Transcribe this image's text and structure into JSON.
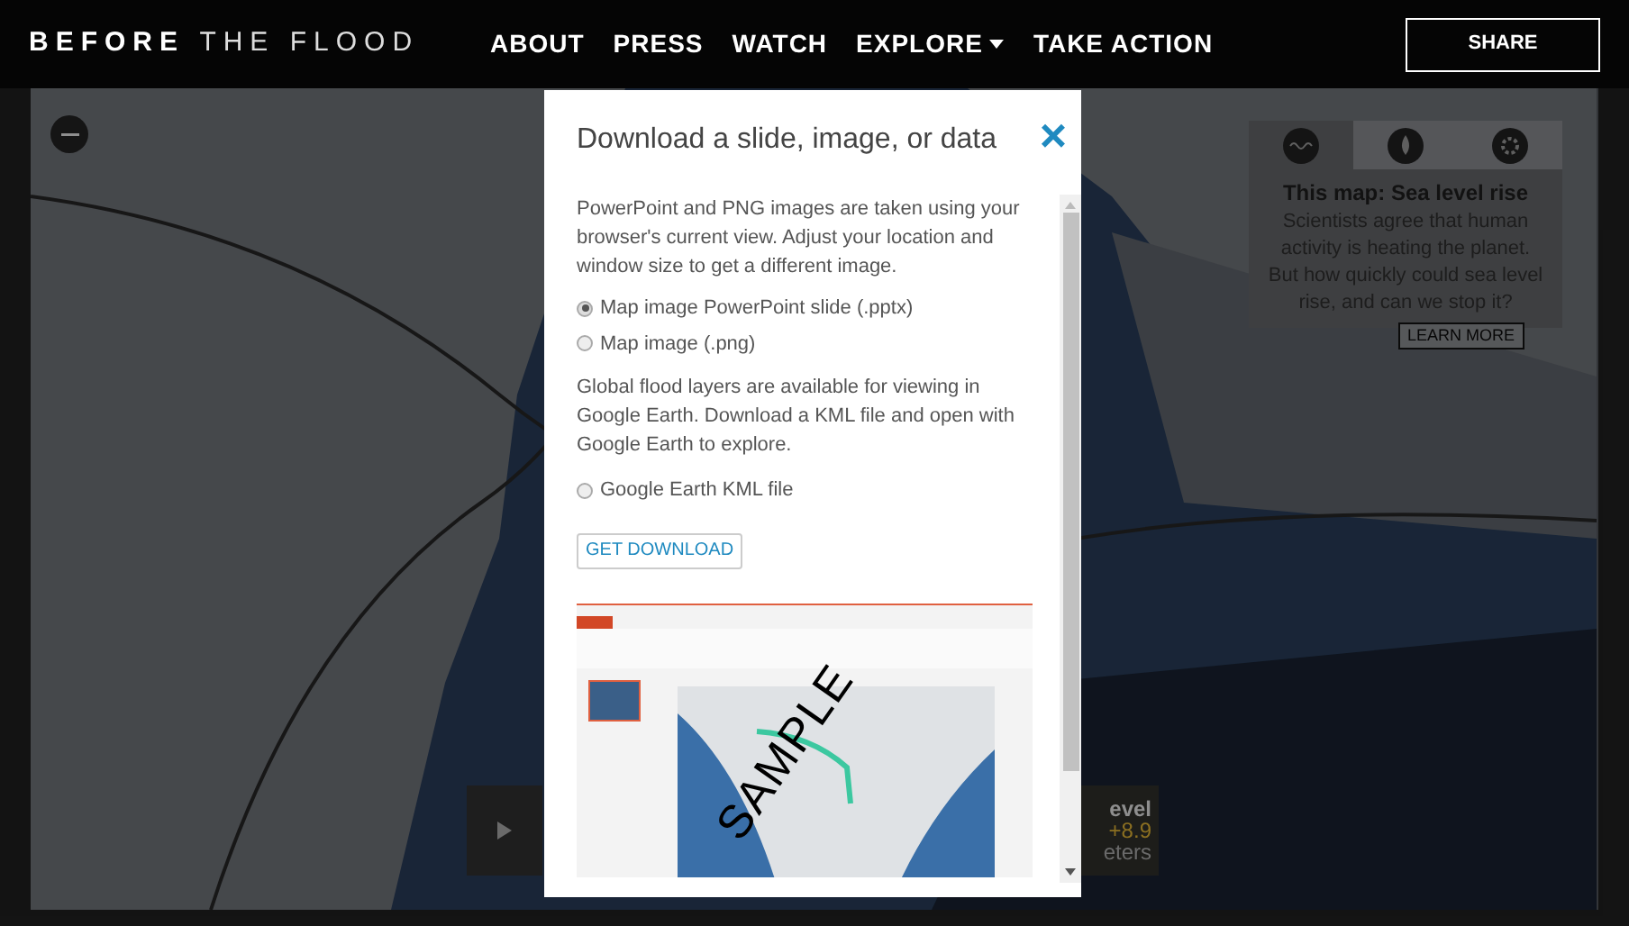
{
  "header": {
    "logo_bold": "BEFORE",
    "logo_light": "THE FLOOD",
    "nav": [
      {
        "label": "ABOUT",
        "dropdown": false
      },
      {
        "label": "PRESS",
        "dropdown": false
      },
      {
        "label": "WATCH",
        "dropdown": false
      },
      {
        "label": "EXPLORE",
        "dropdown": true
      },
      {
        "label": "TAKE ACTION",
        "dropdown": false
      }
    ],
    "share": "SHARE"
  },
  "info_panel": {
    "tabs": [
      {
        "kind": "wave",
        "selected": true
      },
      {
        "kind": "drop",
        "selected": false
      },
      {
        "kind": "sun",
        "selected": false
      }
    ],
    "title": "This map: Sea level rise",
    "text": "Scientists agree that human activity is heating the planet. But how quickly could sea level rise, and can we stop it?",
    "button": "LEARN MORE"
  },
  "level_panel": {
    "label": "evel",
    "value": "+8.9",
    "unit": "eters"
  },
  "modal": {
    "title": "Download a slide, image, or data",
    "close": "×",
    "intro": "PowerPoint and PNG images are taken using your browser's current view. Adjust your location and window size to get a different image.",
    "options_a": [
      {
        "label": "Map image PowerPoint slide (.pptx)",
        "selected": true
      },
      {
        "label": "Map image (.png)",
        "selected": false
      }
    ],
    "kml_text": "Global flood layers are available for viewing in Google Earth. Download a KML file and open with Google Earth to explore.",
    "options_b": [
      {
        "label": "Google Earth KML file",
        "selected": false
      }
    ],
    "button": "GET DOWNLOAD",
    "sample": "SAMPLE"
  }
}
